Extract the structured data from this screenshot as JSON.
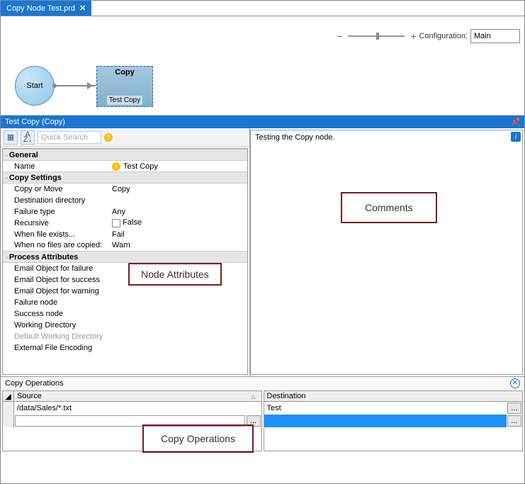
{
  "tab": {
    "title": "Copy Node Test.prd",
    "close": "✕"
  },
  "config": {
    "label": "Configuration:",
    "value": "Main",
    "minus": "−",
    "plus": "+"
  },
  "nodes": {
    "start": "Start",
    "copy_title": "Copy",
    "copy_subtitle": "Test Copy"
  },
  "panel": {
    "title": "Test Copy (Copy)"
  },
  "toolbar": {
    "search_placeholder": "Quick Search",
    "cat_icon": "▦",
    "sort_icon": "A↓",
    "sort_icon2": "Z↓"
  },
  "props": {
    "sect_general": "General",
    "name_lbl": "Name",
    "name_val": "Test Copy",
    "sect_copy": "Copy Settings",
    "cm_lbl": "Copy or Move",
    "cm_val": "Copy",
    "dd_lbl": "Destination directory",
    "dd_val": "",
    "ft_lbl": "Failure type",
    "ft_val": "Any",
    "rec_lbl": "Recursive",
    "rec_val": "False",
    "wfe_lbl": "When file exists...",
    "wfe_val": "Fail",
    "wnf_lbl": "When no files are copied:",
    "wnf_val": "Warn",
    "sect_proc": "Process Attributes",
    "eof_lbl": "Email Object for failure",
    "eos_lbl": "Email Object for success",
    "eow_lbl": "Email Object for warning",
    "fn_lbl": "Failure node",
    "sn_lbl": "Success node",
    "wd_lbl": "Working Directory",
    "dwd_lbl": "Default Working Directory",
    "efe_lbl": "External File Encoding"
  },
  "comments": {
    "text": "Testing the Copy node."
  },
  "ops": {
    "title": "Copy Operations",
    "src_hdr": "Source",
    "dst_hdr": "Destination",
    "row1_src": "/data/Sales/*.txt",
    "row1_dst": "Test",
    "browse": "...",
    "corner_arrow": "◢",
    "sort_asc": "△"
  },
  "annotations": {
    "node_attrs": "Node Attributes",
    "comments": "Comments",
    "copy_ops": "Copy Operations"
  }
}
